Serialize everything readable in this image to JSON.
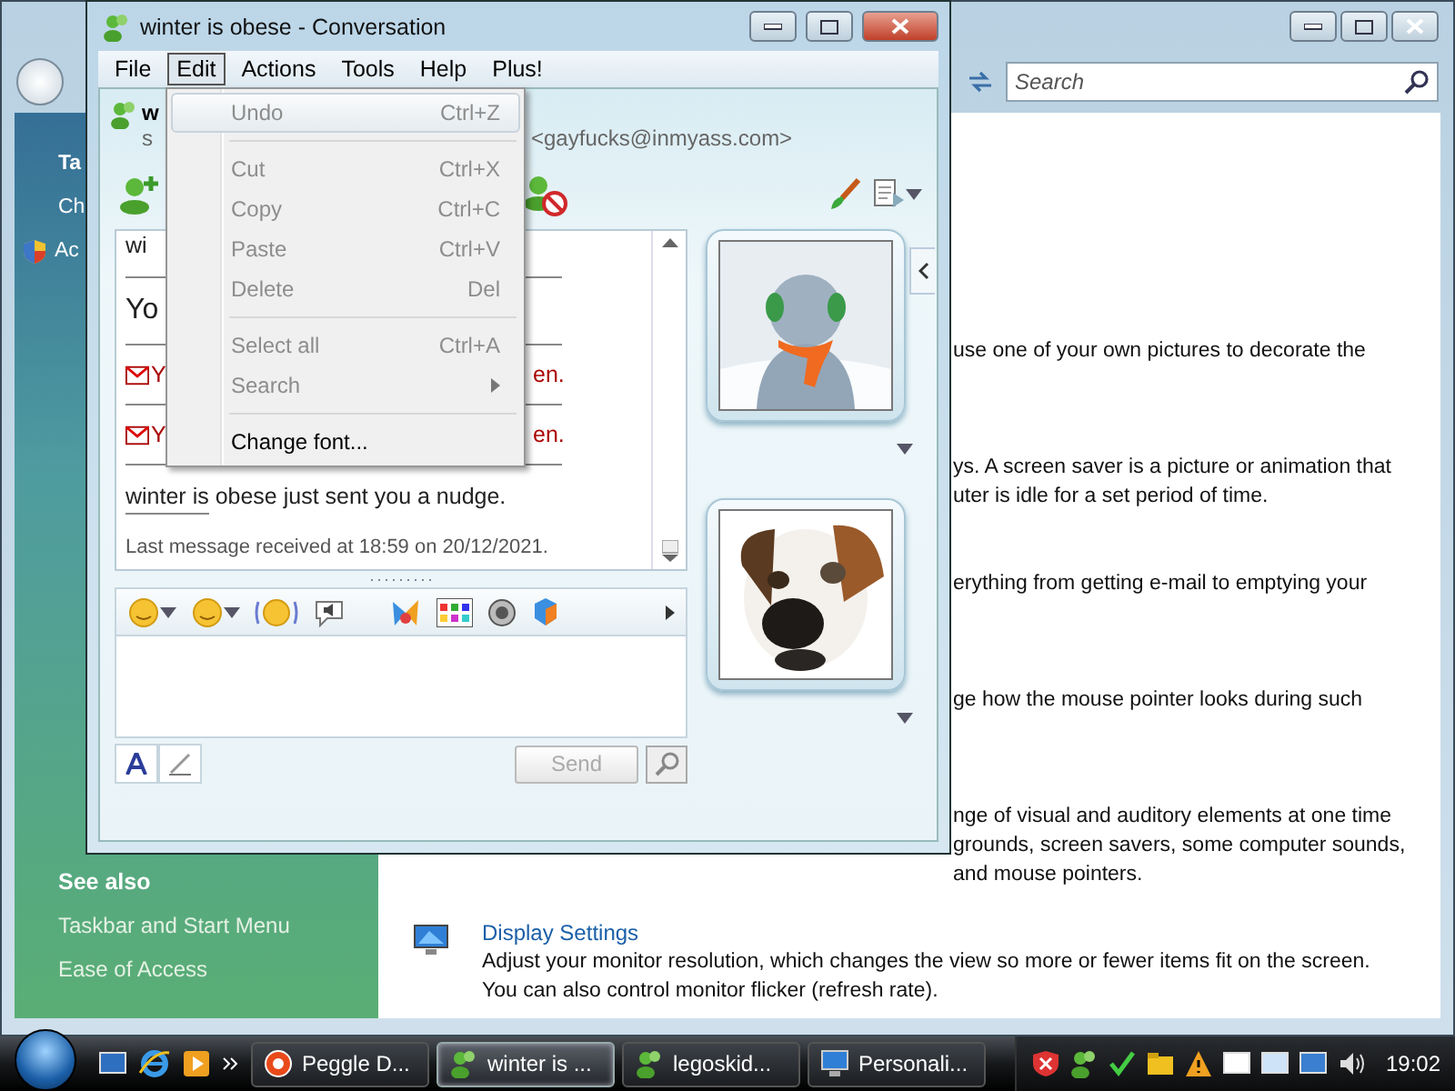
{
  "control_panel": {
    "search": {
      "placeholder": "Search"
    },
    "sidebar": {
      "tasks": [
        {
          "label": "Ta",
          "kind": "heading"
        },
        {
          "label": "Ch",
          "kind": "link"
        },
        {
          "label": "Ac",
          "kind": "shield"
        }
      ],
      "see_also_title": "See also",
      "see_also": [
        "Taskbar and Start Menu",
        "Ease of Access"
      ]
    },
    "items": [
      {
        "kind": "partial",
        "lines": [
          "use one of your own pictures to decorate the"
        ]
      },
      {
        "kind": "partial",
        "lines": [
          "ys. A screen saver is a picture or animation that",
          "uter is idle for a set period of time."
        ]
      },
      {
        "kind": "partial",
        "lines": [
          "erything from getting e-mail to emptying your"
        ]
      },
      {
        "kind": "partial",
        "lines": [
          "ge how the mouse pointer looks during such"
        ]
      },
      {
        "kind": "partial",
        "lines": [
          "nge of visual and auditory elements at one time",
          "grounds, screen savers, some computer sounds,",
          "and mouse pointers."
        ]
      },
      {
        "kind": "full",
        "title": "Display Settings",
        "lines": [
          "Adjust your monitor resolution, which changes the view so more or fewer items fit on the screen.",
          "You can also control monitor flicker (refresh rate)."
        ]
      }
    ]
  },
  "messenger": {
    "title": "winter is obese - Conversation",
    "menu": [
      {
        "label": "File",
        "selected": false
      },
      {
        "label": "Edit",
        "selected": true
      },
      {
        "label": "Actions",
        "selected": false
      },
      {
        "label": "Tools",
        "selected": false
      },
      {
        "label": "Help",
        "selected": false
      },
      {
        "label": "Plus!",
        "selected": false
      }
    ],
    "edit_menu": [
      {
        "kind": "item",
        "label": "Undo",
        "shortcut": "Ctrl+Z",
        "disabled": true,
        "selected": true
      },
      {
        "kind": "separator"
      },
      {
        "kind": "item",
        "label": "Cut",
        "shortcut": "Ctrl+X",
        "disabled": true,
        "selected": false
      },
      {
        "kind": "item",
        "label": "Copy",
        "shortcut": "Ctrl+C",
        "disabled": true,
        "selected": false
      },
      {
        "kind": "item",
        "label": "Paste",
        "shortcut": "Ctrl+V",
        "disabled": true,
        "selected": false
      },
      {
        "kind": "item",
        "label": "Delete",
        "shortcut": "Del",
        "disabled": true,
        "selected": false
      },
      {
        "kind": "separator"
      },
      {
        "kind": "item",
        "label": "Select all",
        "shortcut": "Ctrl+A",
        "disabled": true,
        "selected": false
      },
      {
        "kind": "submenu",
        "label": "Search",
        "disabled": true,
        "selected": false
      },
      {
        "kind": "separator"
      },
      {
        "kind": "item",
        "label": "Change font...",
        "disabled": false,
        "selected": false
      }
    ],
    "contact": {
      "name": "w",
      "status": "s",
      "email": "<gayfucks@inmyass.com>"
    },
    "history": [
      {
        "kind": "cut",
        "text": "wi"
      },
      {
        "kind": "sender",
        "text": "Yo"
      },
      {
        "kind": "offline",
        "left": "Y",
        "right": "en."
      },
      {
        "kind": "offline",
        "left": "Y",
        "right": "en."
      },
      {
        "kind": "nudge",
        "text": "winter is obese just sent you a nudge."
      }
    ],
    "last_message": "Last message received at 18:59 on 20/12/2021.",
    "send": {
      "label": "Send",
      "disabled": true
    }
  },
  "taskbar": {
    "tasks": [
      {
        "label": "Peggle D...",
        "kind": "game",
        "selected": false
      },
      {
        "label": "winter is ...",
        "kind": "chat",
        "selected": true
      },
      {
        "label": "legoskid...",
        "kind": "chat",
        "selected": false
      },
      {
        "label": "Personali...",
        "kind": "display",
        "selected": false
      }
    ],
    "clock": "19:02"
  }
}
